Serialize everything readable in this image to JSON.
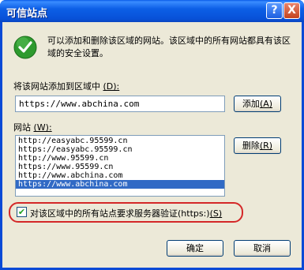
{
  "window": {
    "title": "可信站点",
    "help_glyph": "?",
    "close_glyph": "X"
  },
  "description": "可以添加和删除该区域的网站。该区域中的所有网站都具有该区域的安全设置。",
  "add_section": {
    "label": "将该网站添加到区域中",
    "label_key": "(D):",
    "input_value": "https://www.abchina.com",
    "add_button": "添加",
    "add_button_key": "(A)"
  },
  "sites_section": {
    "label": "网站",
    "label_key": "(W):",
    "items": [
      "http://easyabc.95599.cn",
      "https://easyabc.95599.cn",
      "http://www.95599.cn",
      "https://www.95599.cn",
      "http://www.abchina.com",
      "https://www.abchina.com"
    ],
    "selected_index": 5,
    "remove_button": "删除",
    "remove_button_key": "(R)"
  },
  "https_checkbox": {
    "checked": true,
    "label": "对该区域中的所有站点要求服务器验证(https:)",
    "label_key": "(S)"
  },
  "footer": {
    "ok": "确定",
    "cancel": "取消"
  }
}
